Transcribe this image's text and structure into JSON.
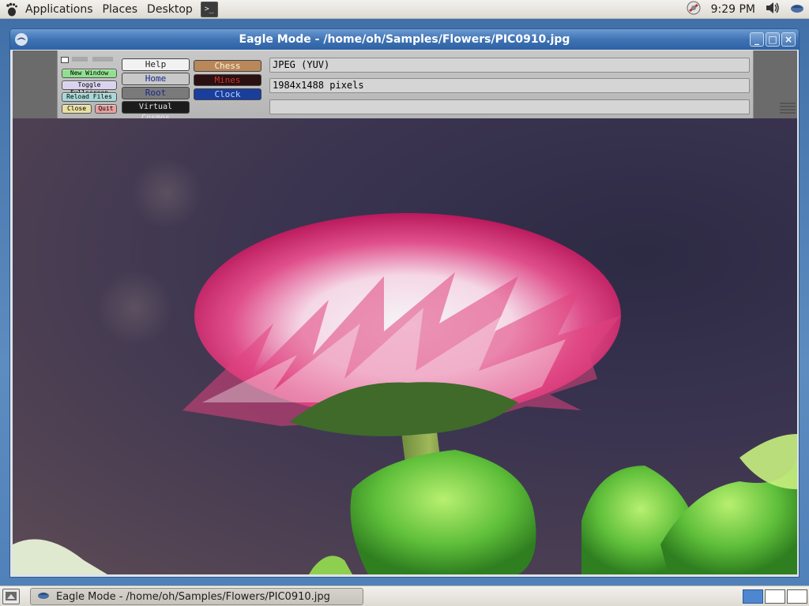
{
  "top_panel": {
    "menus": [
      "Applications",
      "Places",
      "Desktop"
    ],
    "clock": "9:29 PM",
    "icons": [
      "gnome-foot-icon",
      "terminal-icon",
      "network-icon",
      "volume-icon",
      "eagle-icon"
    ]
  },
  "window": {
    "title": "Eagle Mode - /home/oh/Samples/Flowers/PIC0910.jpg",
    "buttons": [
      "minimize",
      "maximize",
      "close"
    ]
  },
  "control_panel": {
    "general_buttons": {
      "new_window": "New Window",
      "toggle_fullscreen": "Toggle Fullscreen",
      "reload_files": "Reload Files",
      "close": "Close",
      "quit": "Quit"
    },
    "bookmarks": {
      "help": "Help",
      "home": "Home",
      "root": "Root",
      "virtual_cosmos": "Virtual Cosmos",
      "chess": "Chess",
      "mines": "Mines",
      "clock": "Clock"
    },
    "file_info": {
      "format": "JPEG (YUV)",
      "size": "1984x1488 pixels",
      "comment": ""
    }
  },
  "bottom_panel": {
    "task": "Eagle Mode - /home/oh/Samples/Flowers/PIC0910.jpg",
    "workspaces": 3
  },
  "colors": {
    "title_bar": "#3f73b4",
    "help_btn": "#f2f2f2",
    "chess_btn": "#b8875a",
    "mines_btn": "#2a1010",
    "clock_btn": "#1a3e9c",
    "new_window_btn": "#7fd27f",
    "quit_btn": "#e8a0a0"
  }
}
